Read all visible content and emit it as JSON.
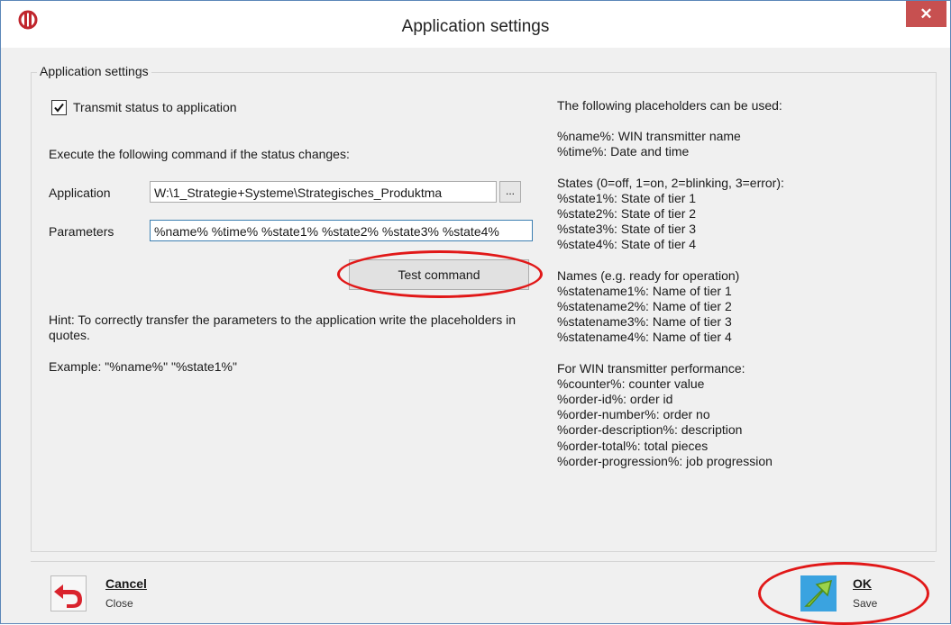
{
  "window": {
    "title": "Application settings",
    "close_glyph": "✕"
  },
  "group": {
    "legend": "Application settings"
  },
  "form": {
    "transmit_checkbox": {
      "label": "Transmit status to application",
      "checked": true
    },
    "command_intro": "Execute the following command if the status changes:",
    "application_label": "Application",
    "application_value": "W:\\1_Strategie+Systeme\\Strategisches_Produktma",
    "browse_label": "...",
    "parameters_label": "Parameters",
    "parameters_value": "%name% %time% %state1% %state2% %state3% %state4%",
    "test_button": "Test command"
  },
  "hint": {
    "text": "Hint: To correctly transfer the parameters to the application write the placeholders in quotes.",
    "example": "Example: \"%name%\" \"%state1%\""
  },
  "placeholders": {
    "heading": "The following placeholders can be used:",
    "general": [
      "%name%: WIN transmitter name",
      "%time%: Date and time"
    ],
    "states_heading": "States (0=off, 1=on, 2=blinking, 3=error):",
    "states": [
      "%state1%: State of tier 1",
      "%state2%: State of tier 2",
      "%state3%: State of tier 3",
      "%state4%: State of tier 4"
    ],
    "names_heading": "Names (e.g. ready for operation)",
    "names": [
      "%statename1%: Name of tier 1",
      "%statename2%: Name of tier 2",
      "%statename3%: Name of tier 3",
      "%statename4%: Name of tier 4"
    ],
    "performance_heading": "For WIN transmitter performance:",
    "performance": [
      "%counter%: counter value",
      "%order-id%: order id",
      "%order-number%: order no",
      "%order-description%: description",
      "%order-total%: total pieces",
      "%order-progression%: job progression"
    ]
  },
  "footer": {
    "cancel": {
      "label": "Cancel",
      "sub": "Close",
      "icon": "undo-arrow-icon"
    },
    "ok": {
      "label": "OK",
      "sub": "Save",
      "icon": "green-arrow-icon"
    }
  },
  "colors": {
    "close_button": "#c75050",
    "highlight": "#e11818",
    "ok_icon_bg": "#3aa3e0",
    "cancel_arrow": "#d9232d"
  }
}
